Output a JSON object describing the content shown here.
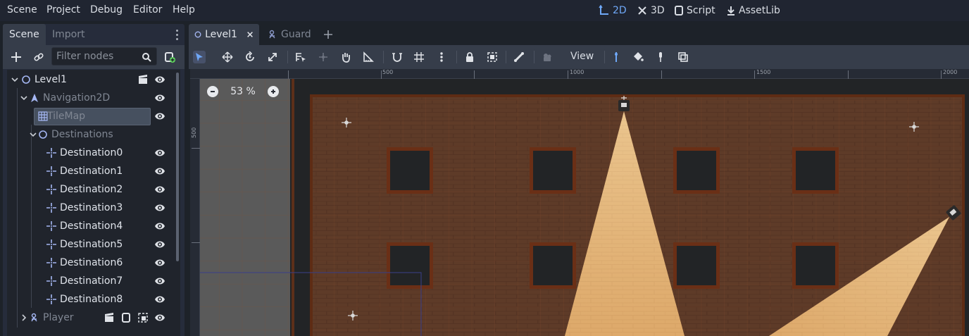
{
  "menu": [
    "Scene",
    "Project",
    "Debug",
    "Editor",
    "Help"
  ],
  "workspaces": [
    {
      "label": "2D",
      "icon": "2d-icon",
      "active": true
    },
    {
      "label": "3D",
      "icon": "3d-icon",
      "active": false
    },
    {
      "label": "Script",
      "icon": "script-icon",
      "active": false
    },
    {
      "label": "AssetLib",
      "icon": "assetlib-icon",
      "active": false
    }
  ],
  "dock": {
    "tabs": [
      "Scene",
      "Import"
    ],
    "filter_placeholder": "Filter nodes"
  },
  "tree": [
    {
      "label": "Level1",
      "icon": "node2d-icon"
    },
    {
      "label": "Navigation2D",
      "icon": "navigation2d-icon"
    },
    {
      "label": "TileMap",
      "icon": "tilemap-icon",
      "selected": true
    },
    {
      "label": "Destinations",
      "icon": "node2d-icon"
    },
    {
      "label": "Destination0",
      "icon": "position2d-icon"
    },
    {
      "label": "Destination1",
      "icon": "position2d-icon"
    },
    {
      "label": "Destination2",
      "icon": "position2d-icon"
    },
    {
      "label": "Destination3",
      "icon": "position2d-icon"
    },
    {
      "label": "Destination4",
      "icon": "position2d-icon"
    },
    {
      "label": "Destination5",
      "icon": "position2d-icon"
    },
    {
      "label": "Destination6",
      "icon": "position2d-icon"
    },
    {
      "label": "Destination7",
      "icon": "position2d-icon"
    },
    {
      "label": "Destination8",
      "icon": "position2d-icon"
    },
    {
      "label": "Player",
      "icon": "kinematicbody-icon"
    }
  ],
  "doc_tabs": [
    {
      "label": "Level1",
      "active": true
    },
    {
      "label": "Guard",
      "active": false
    }
  ],
  "toolbar": {
    "view_label": "View"
  },
  "ruler": {
    "top_labels": [
      "500",
      "1000",
      "1500",
      "2000"
    ],
    "left_labels": [
      "500"
    ]
  },
  "zoom": {
    "label": "53 %"
  },
  "colors": {
    "accent": "#6fa8f7",
    "panel": "#262c3b",
    "tree_bg": "#20242c",
    "brick": "#5e3b28",
    "light": "#f5c88a"
  }
}
